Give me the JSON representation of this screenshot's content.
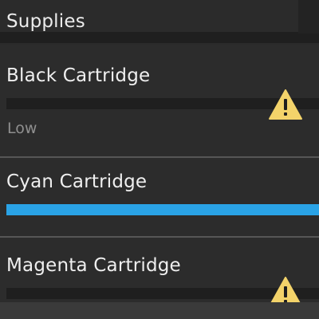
{
  "header": {
    "title": "Supplies"
  },
  "supplies": [
    {
      "name": "Black Cartridge",
      "status": "Low",
      "level": 0.0,
      "warning_icon": "warning-triangle-icon"
    },
    {
      "name": "Cyan Cartridge",
      "status": "",
      "level": 1.0,
      "warning_icon": ""
    },
    {
      "name": "Magenta Cartridge",
      "status": "",
      "level": 0.0,
      "warning_icon": "warning-triangle-icon"
    }
  ],
  "colors": {
    "cyan_bar": "#2aa3e6",
    "warning": "#f3d36a",
    "background": "#2c2c2c"
  }
}
